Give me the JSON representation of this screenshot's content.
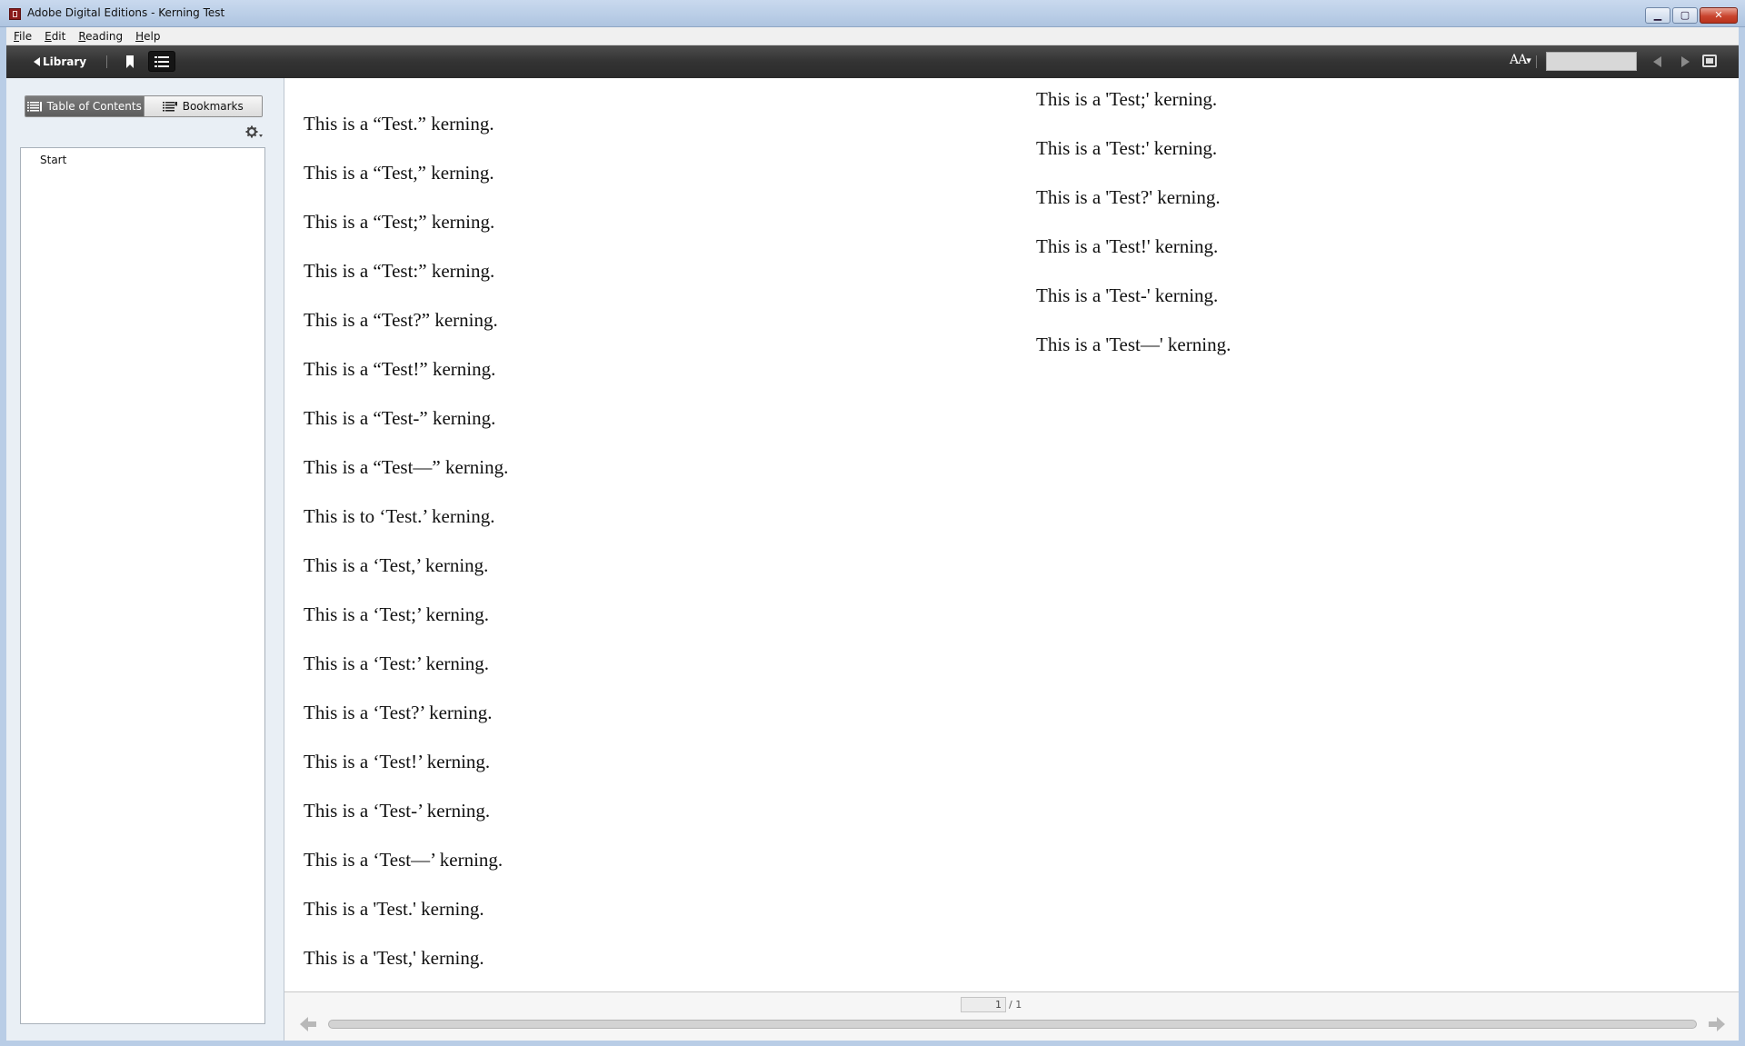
{
  "window": {
    "title": "Adobe Digital Editions - Kerning Test",
    "min": "▁",
    "max": "▢",
    "close": "✕"
  },
  "menu": {
    "file": {
      "u": "F",
      "rest": "ile"
    },
    "edit": {
      "u": "E",
      "rest": "dit"
    },
    "reading": {
      "u": "R",
      "rest": "eading"
    },
    "help": {
      "u": "H",
      "rest": "elp"
    }
  },
  "toolbar": {
    "library_label": "Library",
    "font_size_label": "AA",
    "font_size_suffix": "▾",
    "search_value": ""
  },
  "sidebar": {
    "tab_toc": "Table of Contents",
    "tab_bookmarks": "Bookmarks",
    "toc_items": [
      "Start"
    ]
  },
  "content": {
    "left_column": [
      "This is a “Test.” kerning.",
      "This is a “Test,” kerning.",
      "This is a “Test;” kerning.",
      "This is a “Test:” kerning.",
      "This is a “Test?” kerning.",
      "This is a “Test!” kerning.",
      "This is a “Test-” kerning.",
      "This is a “Test—” kerning.",
      "This is to ‘Test.’ kerning.",
      "This is a ‘Test,’ kerning.",
      "This is a ‘Test;’ kerning.",
      "This is a ‘Test:’ kerning.",
      "This is a ‘Test?’ kerning.",
      "This is a ‘Test!’ kerning.",
      "This is a ‘Test-’ kerning.",
      "This is a ‘Test—’ kerning.",
      "This is a 'Test.' kerning.",
      "This is a 'Test,' kerning."
    ],
    "right_column": [
      "This is a 'Test;' kerning.",
      "This is a 'Test:' kerning.",
      "This is a 'Test?' kerning.",
      "This is a 'Test!' kerning.",
      "This is a 'Test-' kerning.",
      "This is a 'Test—' kerning."
    ]
  },
  "pager": {
    "current_page": "1",
    "total": "/ 1"
  }
}
